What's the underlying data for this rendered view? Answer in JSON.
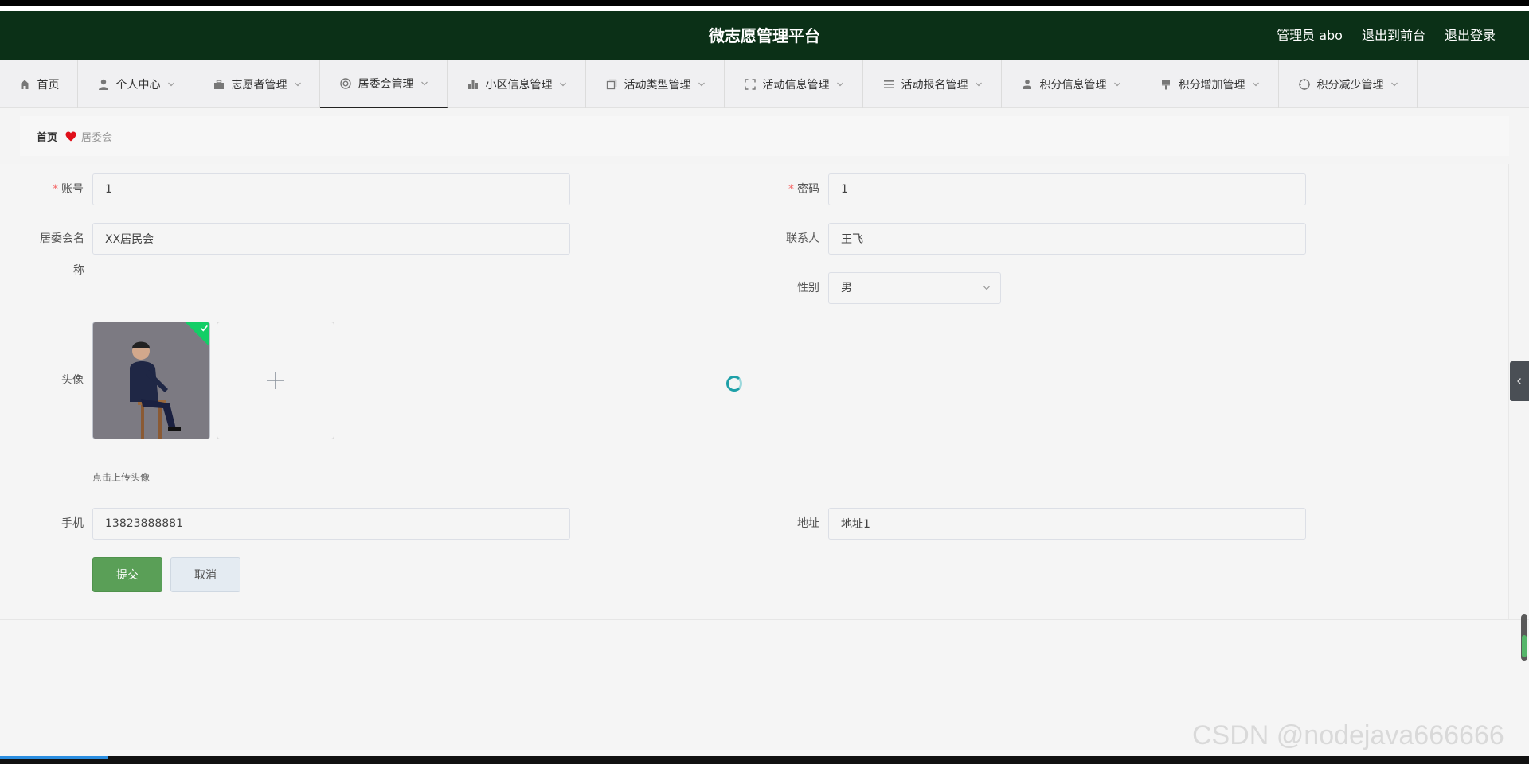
{
  "header": {
    "title": "微志愿管理平台",
    "user": "管理员 abo",
    "to_front": "退出到前台",
    "logout": "退出登录"
  },
  "nav": {
    "items": [
      {
        "label": "首页",
        "icon": "home-icon",
        "has_caret": false
      },
      {
        "label": "个人中心",
        "icon": "user-icon",
        "has_caret": true
      },
      {
        "label": "志愿者管理",
        "icon": "briefcase-icon",
        "has_caret": true
      },
      {
        "label": "居委会管理",
        "icon": "lifebuoy-icon",
        "has_caret": true
      },
      {
        "label": "小区信息管理",
        "icon": "bar-chart-icon",
        "has_caret": true
      },
      {
        "label": "活动类型管理",
        "icon": "copy-icon",
        "has_caret": true
      },
      {
        "label": "活动信息管理",
        "icon": "frame-icon",
        "has_caret": true
      },
      {
        "label": "活动报名管理",
        "icon": "list-icon",
        "has_caret": true
      },
      {
        "label": "积分信息管理",
        "icon": "person-icon",
        "has_caret": true
      },
      {
        "label": "积分增加管理",
        "icon": "brush-icon",
        "has_caret": true
      },
      {
        "label": "积分减少管理",
        "icon": "compass-icon",
        "has_caret": true
      }
    ],
    "active_index": 3
  },
  "breadcrumb": {
    "home": "首页",
    "current": "居委会"
  },
  "form": {
    "account_label": "账号",
    "account_value": "1",
    "password_label": "密码",
    "password_value": "1",
    "name_label": "居委会名称",
    "name_value": "XX居民会",
    "contact_label": "联系人",
    "contact_value": "王飞",
    "gender_label": "性别",
    "gender_value": "男",
    "avatar_label": "头像",
    "avatar_tip": "点击上传头像",
    "phone_label": "手机",
    "phone_value": "13823888881",
    "address_label": "地址",
    "address_value": "地址1",
    "submit_label": "提交",
    "cancel_label": "取消"
  },
  "watermark": "CSDN @nodejava666666",
  "colors": {
    "header_bg": "#0b3017",
    "submit_bg": "#5a9f57",
    "required": "#f56c6c",
    "heart": "#e0101a",
    "upload_success": "#13ce66"
  }
}
